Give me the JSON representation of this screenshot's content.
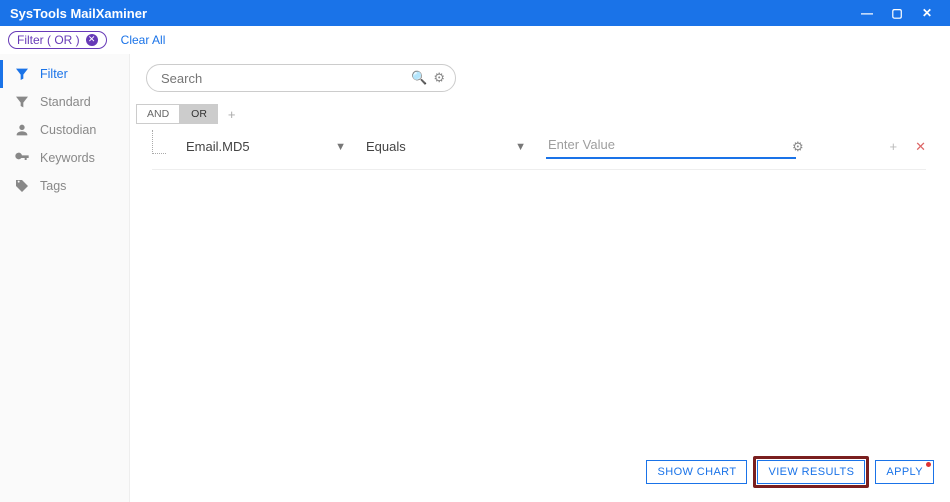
{
  "window": {
    "title": "SysTools MailXaminer"
  },
  "filterbar": {
    "chip": "Filter ( OR )",
    "clear": "Clear All"
  },
  "sidebar": {
    "items": [
      {
        "label": "Filter"
      },
      {
        "label": "Standard"
      },
      {
        "label": "Custodian"
      },
      {
        "label": "Keywords"
      },
      {
        "label": "Tags"
      }
    ]
  },
  "search": {
    "placeholder": "Search"
  },
  "logic": {
    "and": "AND",
    "or": "OR"
  },
  "rule": {
    "field": "Email.MD5",
    "operator": "Equals",
    "value_placeholder": "Enter Value"
  },
  "footer": {
    "show_chart": "SHOW CHART",
    "view_results": "VIEW RESULTS",
    "apply": "APPLY"
  }
}
